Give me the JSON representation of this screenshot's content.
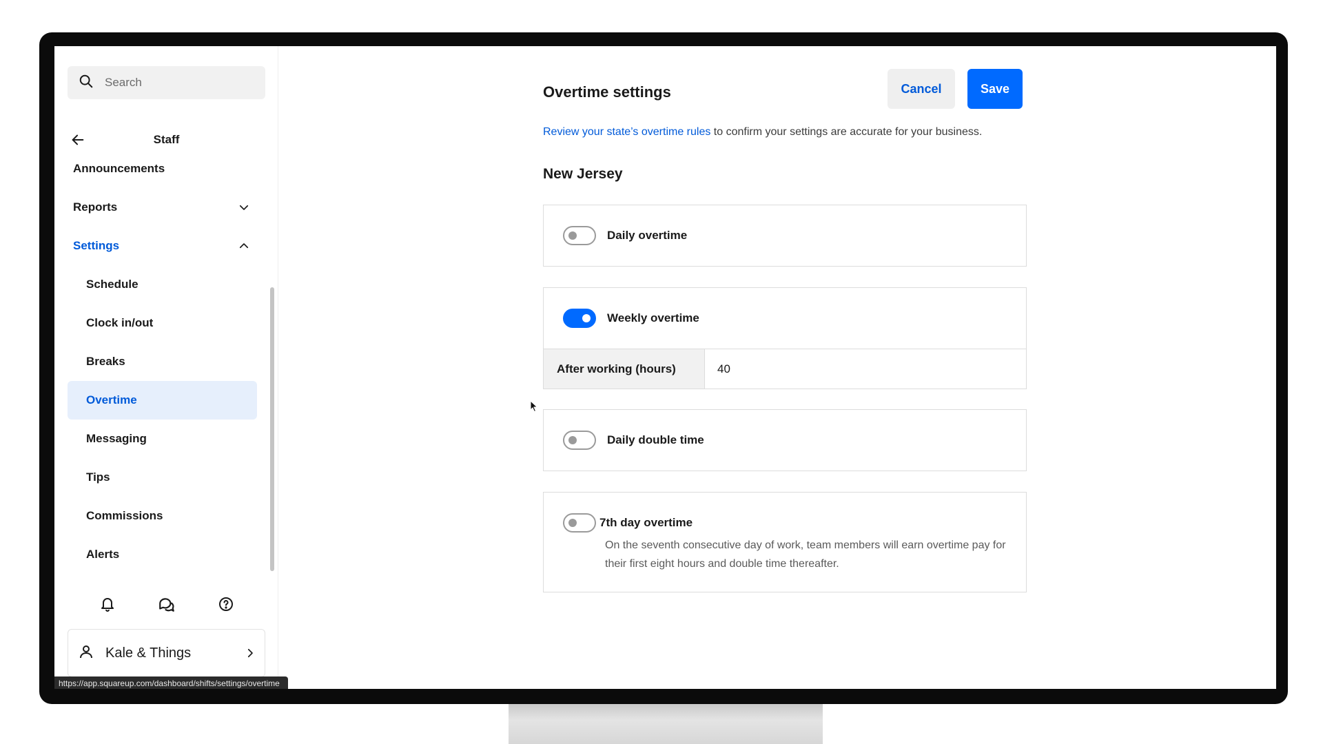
{
  "sidebar": {
    "search_placeholder": "Search",
    "section_title": "Staff",
    "items": [
      {
        "label": "Announcements"
      },
      {
        "label": "Reports"
      },
      {
        "label": "Settings"
      },
      {
        "label": "Schedule"
      },
      {
        "label": "Clock in/out"
      },
      {
        "label": "Breaks"
      },
      {
        "label": "Overtime"
      },
      {
        "label": "Messaging"
      },
      {
        "label": "Tips"
      },
      {
        "label": "Commissions"
      },
      {
        "label": "Alerts"
      }
    ],
    "account_name": "Kale & Things",
    "status_url": "https://app.squareup.com/dashboard/shifts/settings/overtime"
  },
  "main": {
    "title": "Overtime settings",
    "cancel_label": "Cancel",
    "save_label": "Save",
    "intro_link": "Review your state’s overtime rules",
    "intro_text": " to confirm your settings are accurate for your business.",
    "state": "New Jersey",
    "settings": {
      "daily_overtime": {
        "label": "Daily overtime",
        "enabled": false
      },
      "weekly_overtime": {
        "label": "Weekly overtime",
        "enabled": true,
        "hours_label": "After working (hours)",
        "hours_value": "40"
      },
      "daily_double_time": {
        "label": "Daily double time",
        "enabled": false
      },
      "seventh_day": {
        "label": "7th day overtime",
        "enabled": false,
        "description": "On the seventh consecutive day of work, team members will earn overtime pay for their first eight hours and double time thereafter."
      }
    }
  },
  "colors": {
    "accent": "#006aff",
    "link": "#005ad9",
    "selected_bg": "#e6effc"
  }
}
